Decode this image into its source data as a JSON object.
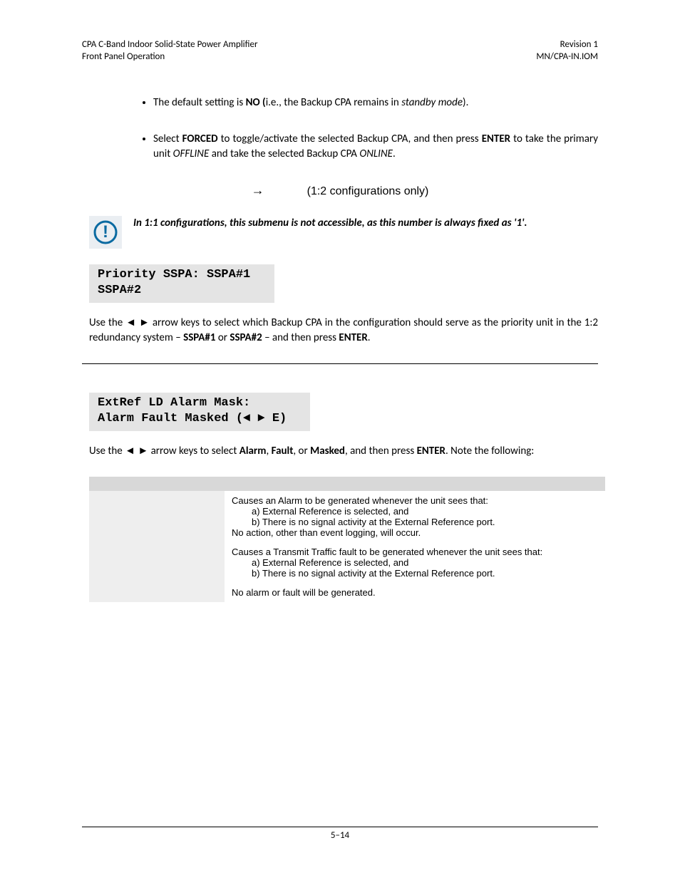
{
  "header": {
    "left1": "CPA C-Band Indoor Solid-State Power Amplifier",
    "left2": "Front Panel Operation",
    "right1": "Revision 1",
    "right2": "MN/CPA-IN.IOM"
  },
  "bullets": {
    "b1_pre": "The default setting is ",
    "b1_bold": "NO (",
    "b1_mid": "i.e., the Backup CPA remains in ",
    "b1_ital": "standby mode",
    "b1_post": ").",
    "b2_pre": "Select ",
    "b2_bold1": "FORCED",
    "b2_mid1": " to toggle/activate the selected Backup CPA, and then press ",
    "b2_bold2": "ENTER",
    "b2_mid2": " to take the primary unit ",
    "b2_ital1": "OFFLINE",
    "b2_mid3": " and take the selected Backup CPA ",
    "b2_ital2": "ONLINE",
    "b2_post": "."
  },
  "arrow": {
    "glyph": "→",
    "text": "(1:2 configurations only)"
  },
  "note": {
    "text": "In 1:1 configurations, this submenu is not accessible, as this number is always fixed as '1'."
  },
  "lcd1": {
    "line1": "Priority SSPA: SSPA#1",
    "line2": "SSPA#2"
  },
  "para1": {
    "p1": "Use the ◄ ► arrow keys to select which Backup CPA in the configuration should serve as the priority unit in the 1:2 redundancy system – ",
    "b1": "SSPA#1",
    "m1": " or ",
    "b2": "SSPA#2",
    "m2": " – and then press ",
    "b3": "ENTER",
    "m3": "."
  },
  "lcd2": {
    "line1": "ExtRef LD Alarm Mask:",
    "line2": "Alarm Fault Masked (◄ ► E)"
  },
  "para2": {
    "p1": "Use the ◄ ► arrow keys to select ",
    "b1": "Alarm",
    "m1": ", ",
    "b2": "Fault",
    "m2": ", or ",
    "b3": "Masked",
    "m3": ", and then press ",
    "b4": "ENTER",
    "m4": ". Note the following:"
  },
  "table": {
    "r1": {
      "d1": "Causes an Alarm to be generated whenever the unit sees that:",
      "d2": "a) External Reference is selected, and",
      "d3": "b) There is no signal activity at the External Reference port.",
      "d4": "No action, other than event logging, will occur."
    },
    "r2": {
      "d1": "Causes a Transmit Traffic fault to be generated whenever the unit sees that:",
      "d2": "a) External Reference is selected, and",
      "d3": "b) There is no signal activity at the External Reference port."
    },
    "r3": {
      "d1": "No alarm or fault will be generated."
    }
  },
  "footer": "5–14"
}
